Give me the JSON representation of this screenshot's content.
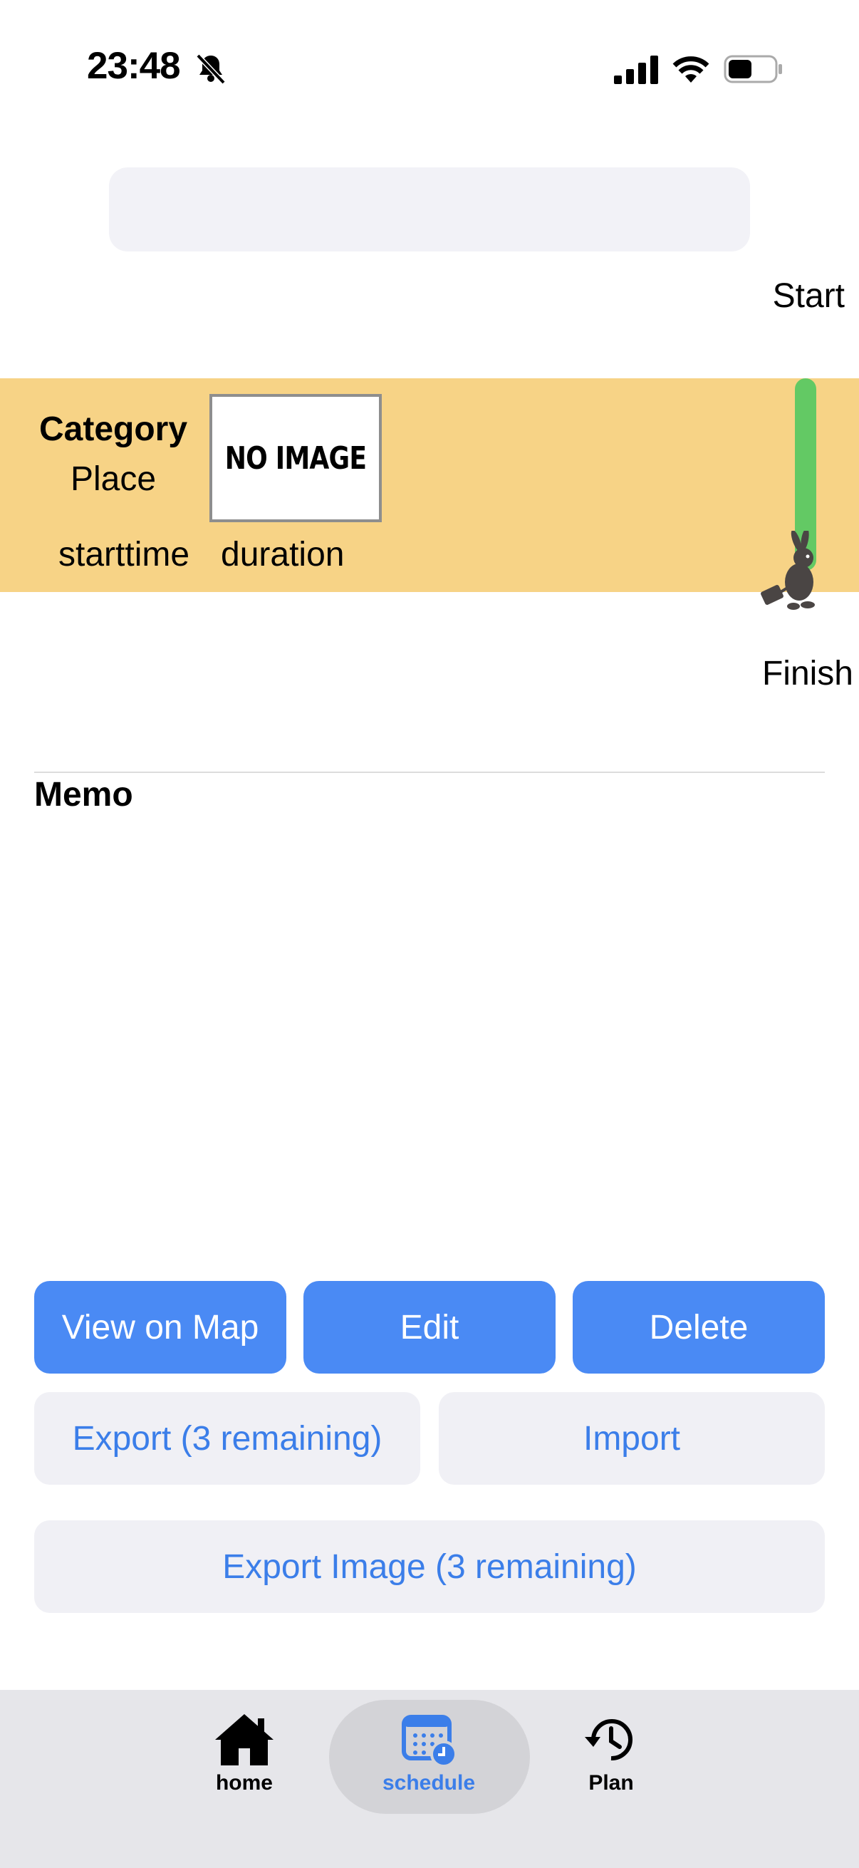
{
  "status_bar": {
    "time": "23:48"
  },
  "schedule": {
    "start_label": "Start",
    "finish_label": "Finish",
    "event": {
      "category": "Category",
      "place": "Place",
      "starttime": "starttime",
      "duration": "duration",
      "image_placeholder": "NO IMAGE"
    },
    "memo_label": "Memo"
  },
  "actions": {
    "view_on_map": "View on Map",
    "edit": "Edit",
    "delete": "Delete",
    "export": "Export (3 remaining)",
    "import": "Import",
    "export_image": "Export Image (3 remaining)"
  },
  "tab_bar": {
    "items": [
      {
        "label": "home",
        "icon": "house-icon"
      },
      {
        "label": "schedule",
        "icon": "calendar-clock-icon",
        "selected": true
      },
      {
        "label": "Plan",
        "icon": "history-clock-icon"
      }
    ]
  },
  "colors": {
    "event_card": "#f7d386",
    "progress": "#63c964",
    "primary_button": "#4a8af4",
    "accent_text": "#3b7ee9"
  }
}
